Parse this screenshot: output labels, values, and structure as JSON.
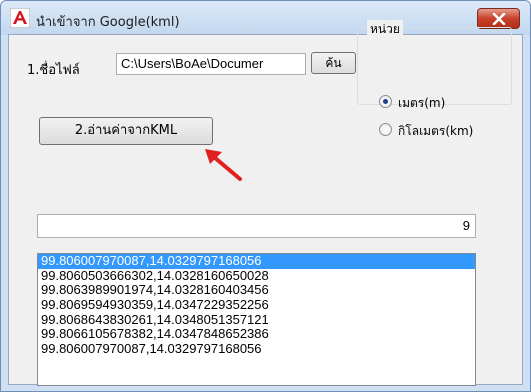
{
  "window": {
    "title": "นำเข้าจาก Google(kml)"
  },
  "file": {
    "label": "1.ชื่อไฟล์",
    "path": "C:\\Users\\BoAe\\Documer",
    "browse_label": "ค้น"
  },
  "units": {
    "legend": "หน่วย",
    "options": [
      {
        "label": "เมตร(m)",
        "checked": true
      },
      {
        "label": "กิโลเมตร(km)",
        "checked": false
      }
    ]
  },
  "read_button": {
    "label": "2.อ่านค่าจากKML"
  },
  "count": {
    "value": "9"
  },
  "coordinates": {
    "items": [
      "99.806007970087,14.0329797168056",
      "99.8060503666302,14.0328160650028",
      "99.8063989901974,14.0328160403456",
      "99.8069594930359,14.0347229352256",
      "99.8068643830261,14.0348051357121",
      "99.8066105678382,14.0347848652386",
      "99.806007970087,14.0329797168056"
    ],
    "selected_index": 0
  },
  "colors": {
    "selection": "#3399ff",
    "arrow": "#e02020",
    "close": "#c8412a"
  },
  "icons": {
    "app": "autocad-icon",
    "close": "close-icon",
    "annotation": "red-arrow"
  }
}
